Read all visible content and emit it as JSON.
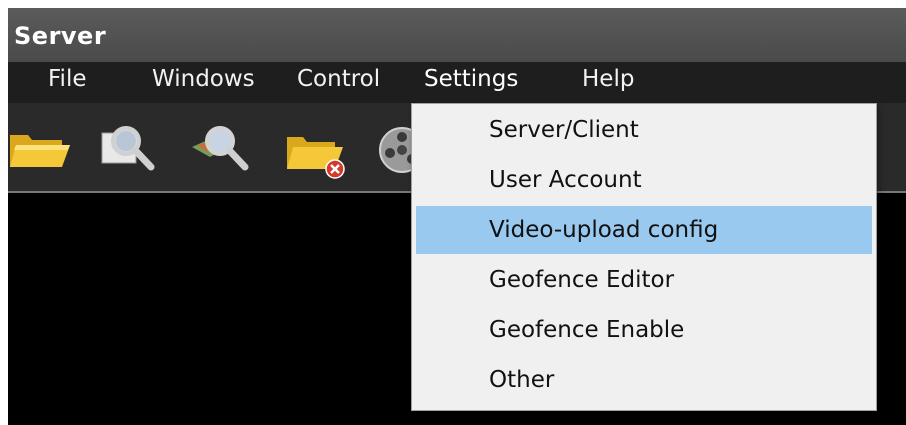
{
  "window": {
    "title": "Server"
  },
  "menubar": {
    "items": [
      {
        "label": "File"
      },
      {
        "label": "Windows"
      },
      {
        "label": "Control"
      },
      {
        "label": "Settings"
      },
      {
        "label": "Help"
      }
    ]
  },
  "toolbar": {
    "buttons": [
      {
        "icon": "open-folder-icon"
      },
      {
        "icon": "search-icon"
      },
      {
        "icon": "map-search-icon"
      },
      {
        "icon": "folder-delete-icon"
      },
      {
        "icon": "film-reel-icon"
      }
    ]
  },
  "settings_menu": {
    "items": [
      {
        "label": "Server/Client"
      },
      {
        "label": "User Account"
      },
      {
        "label": "Video-upload config",
        "highlighted": true
      },
      {
        "label": "Geofence Editor"
      },
      {
        "label": "Geofence Enable"
      },
      {
        "label": "Other"
      }
    ],
    "highlight_color": "#99c9ef"
  },
  "colors": {
    "titlebar": "#555555",
    "menubar": "#1e1e1e",
    "toolbar": "#2a2a2a",
    "content": "#000000",
    "folder": "#f2c22e"
  }
}
